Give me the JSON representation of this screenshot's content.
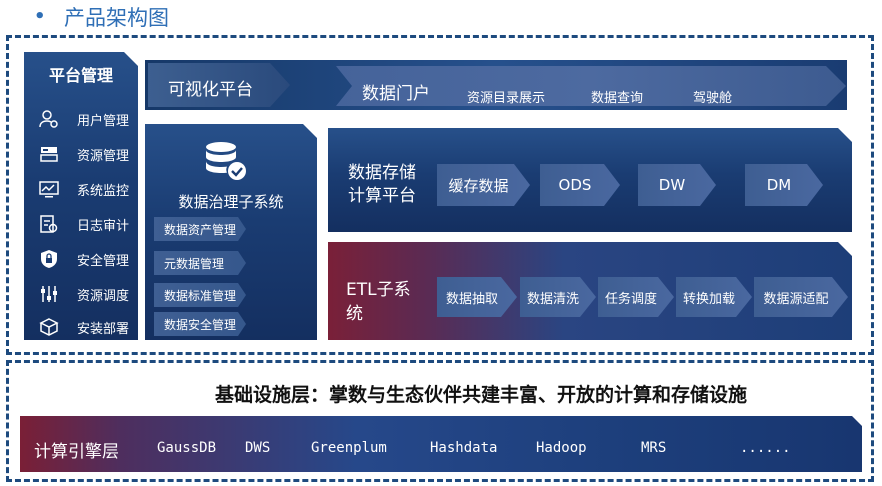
{
  "header": {
    "title": "产品架构图"
  },
  "sidebar": {
    "title": "平台管理",
    "items": [
      {
        "label": "用户管理",
        "icon": "user-settings-icon"
      },
      {
        "label": "资源管理",
        "icon": "server-icon"
      },
      {
        "label": "系统监控",
        "icon": "monitor-chart-icon"
      },
      {
        "label": "日志审计",
        "icon": "log-audit-icon"
      },
      {
        "label": "安全管理",
        "icon": "shield-lock-icon"
      },
      {
        "label": "资源调度",
        "icon": "sliders-icon"
      },
      {
        "label": "安装部署",
        "icon": "install-box-icon"
      }
    ]
  },
  "visualization": {
    "label": "可视化平台",
    "portal": "数据门户",
    "items": [
      "资源目录展示",
      "数据查询",
      "驾驶舱"
    ]
  },
  "governance": {
    "title": "数据治理子系统",
    "items": [
      "数据资产管理",
      "元数据管理",
      "数据标准管理",
      "数据安全管理"
    ]
  },
  "storage": {
    "title_line1": "数据存储",
    "title_line2": "计算平台",
    "items": [
      "缓存数据",
      "ODS",
      "DW",
      "DM"
    ]
  },
  "etl": {
    "title_line1": "ETL子系",
    "title_line2": "统",
    "items": [
      "数据抽取",
      "数据清洗",
      "任务调度",
      "转换加载",
      "数据源适配"
    ]
  },
  "infrastructure": {
    "title": "基础设施层：掌数与生态伙伴共建丰富、开放的计算和存储设施",
    "engine_label": "计算引擎层",
    "engines": [
      "GaussDB",
      "DWS",
      "Greenplum",
      "Hashdata",
      "Hadoop",
      "MRS",
      "......"
    ]
  },
  "colors": {
    "title_blue": "#2f6fb6",
    "frame_dash": "#1d4a7e",
    "panel_dark": "#1a3c72",
    "accent_red": "#7a1f36"
  }
}
